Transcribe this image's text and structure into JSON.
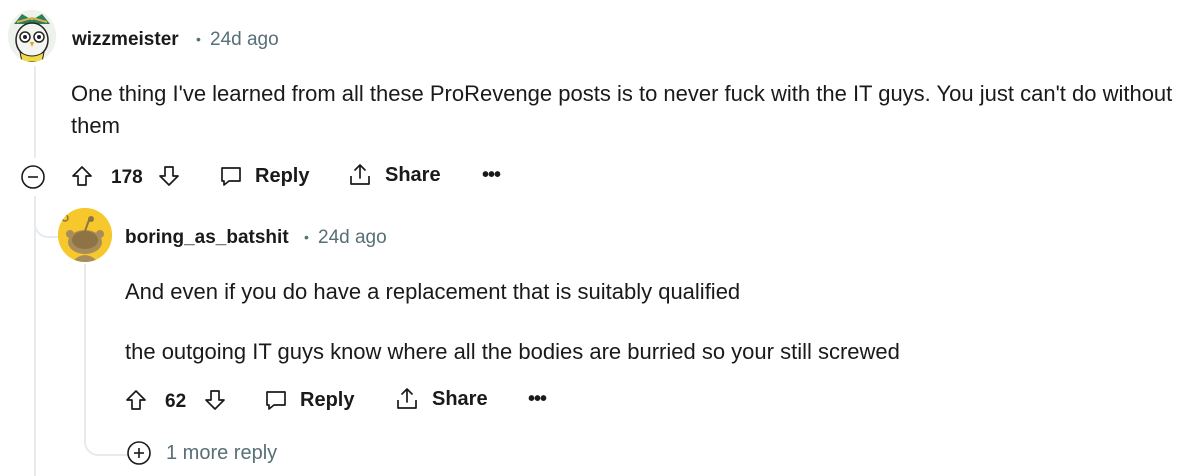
{
  "comments": [
    {
      "author": "wizzmeister",
      "time": "24d ago",
      "body": [
        "One thing I've learned from all these ProRevenge posts is to never fuck with the IT guys. You just can't do without them"
      ],
      "score": "178",
      "reply_label": "Reply",
      "share_label": "Share",
      "avatar_icon": "owl-avatar-icon"
    },
    {
      "author": "boring_as_batshit",
      "time": "24d ago",
      "body": [
        "And even if you do have a replacement that is suitably qualified",
        "the outgoing IT guys know where all the bodies are burried so your still screwed"
      ],
      "score": "62",
      "reply_label": "Reply",
      "share_label": "Share",
      "avatar_icon": "snoo-avatar-icon"
    }
  ],
  "more_replies_label": "1 more reply",
  "separator": "•",
  "overflow_glyph": "•••",
  "colors": {
    "meta_gray": "#576f76",
    "thread_line": "#e5ebee",
    "avatar_yellow": "#f7c82c"
  }
}
